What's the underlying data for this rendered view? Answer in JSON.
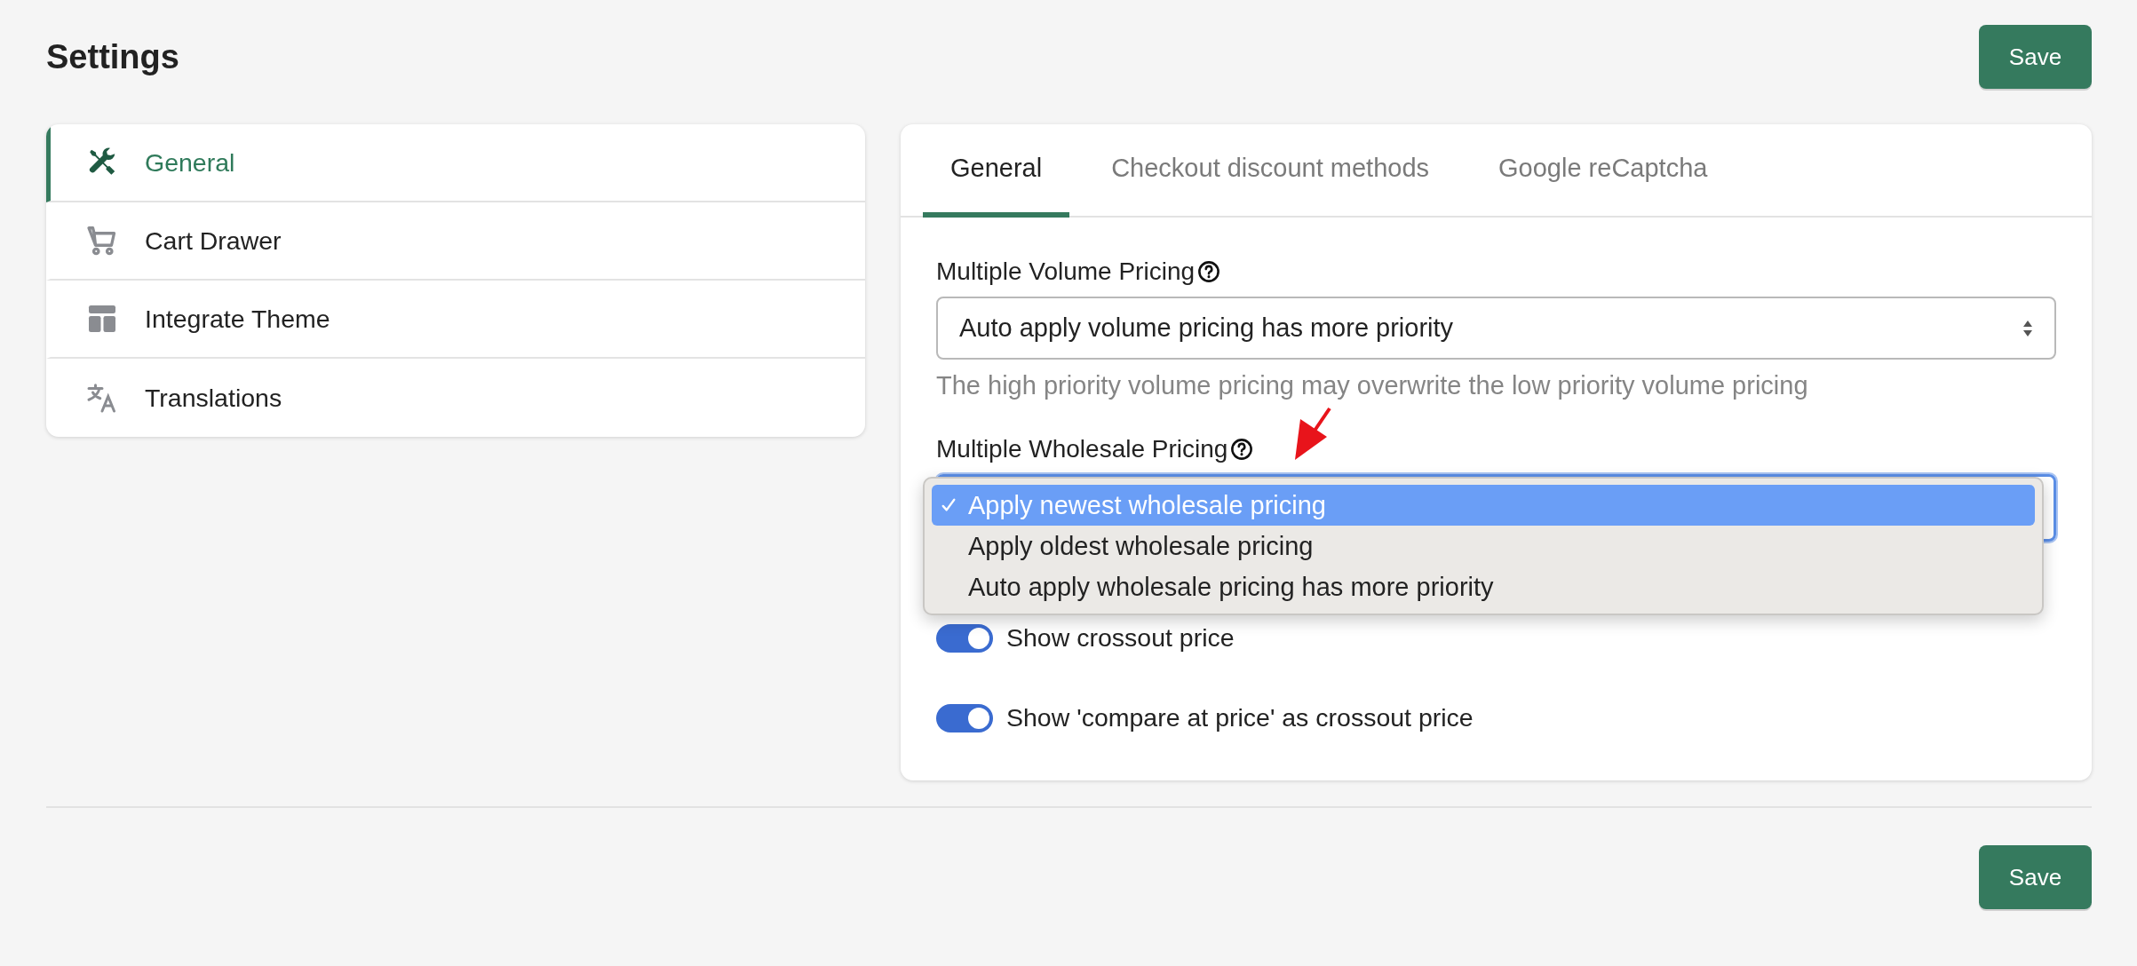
{
  "header": {
    "title": "Settings",
    "save_button": "Save"
  },
  "sidebar": {
    "items": [
      {
        "label": "General",
        "selected": true
      },
      {
        "label": "Cart Drawer",
        "selected": false
      },
      {
        "label": "Integrate Theme",
        "selected": false
      },
      {
        "label": "Translations",
        "selected": false
      }
    ]
  },
  "tabs": [
    {
      "label": "General",
      "selected": true
    },
    {
      "label": "Checkout discount methods",
      "selected": false
    },
    {
      "label": "Google reCaptcha",
      "selected": false
    }
  ],
  "fields": [
    {
      "label": "Multiple Volume Pricing",
      "value": "Auto apply volume pricing has more priority",
      "help": "The high priority volume pricing may overwrite the low priority volume pricing",
      "expanded": false
    },
    {
      "label": "Multiple Wholesale Pricing",
      "expanded": true,
      "options": [
        {
          "label": "Apply newest wholesale pricing",
          "selected": true
        },
        {
          "label": "Apply oldest wholesale pricing",
          "selected": false
        },
        {
          "label": "Auto apply wholesale pricing has more priority",
          "selected": false
        }
      ]
    }
  ],
  "toggles": [
    {
      "label": "Show crossout price",
      "on": true
    },
    {
      "label": "Show 'compare at price' as crossout price",
      "on": true
    }
  ],
  "footer": {
    "save_button": "Save"
  }
}
